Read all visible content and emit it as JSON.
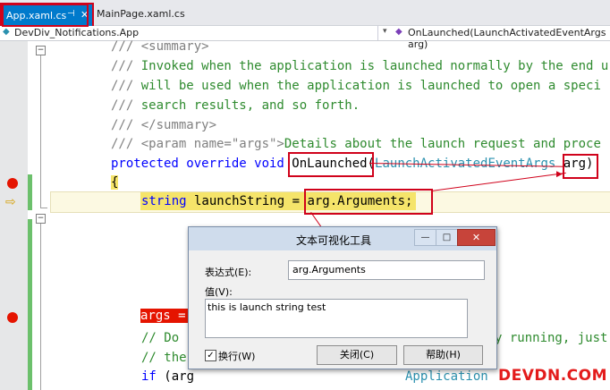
{
  "tabs": {
    "active": "App.xaml.cs",
    "active_pin": "⊣",
    "active_close": "✕",
    "second": "MainPage.xaml.cs"
  },
  "navbar": {
    "class_selector": "DevDiv_Notifications.App",
    "member_selector": "OnLaunched(LaunchActivatedEventArgs arg)"
  },
  "code": {
    "l1": "/// <summary>",
    "l2": "/// Invoked when the application is launched normally by the end u",
    "l3": "/// will be used when the application is launched to open a speci",
    "l4": "/// search results, and so forth.",
    "l5": "/// </summary>",
    "l6_pre": "/// <param name=\"args\">",
    "l6_post": "Details about the launch request and proce",
    "l7_kw": "protected override void ",
    "l7_method": "OnLaunched",
    "l7_paren": "(",
    "l7_type": "LaunchActivatedEventArgs ",
    "l7_arg": "arg",
    "l7_close": ")",
    "l8": "{",
    "l9_kw": "string",
    "l9_mid": " launchString = ",
    "l9_expr": "arg.Arguments;",
    "l14": "args = ",
    "l15a": "// Do ",
    "l15b": "y running, just",
    "l16": "// the",
    "l17a": "if (arg",
    "l17b": "Application"
  },
  "dialog": {
    "title": "文本可视化工具",
    "expr_label": "表达式(E):",
    "expr_value": "arg.Arguments",
    "value_label": "值(V):",
    "value_text": "this is launch string test",
    "wrap_label": "换行(W)",
    "wrap_checked": "✓",
    "close_button": "关闭(C)",
    "help_button": "帮助(H)",
    "min_glyph": "—",
    "max_glyph": "□",
    "close_glyph": "✕"
  },
  "watermark": "DEVDN.COM",
  "colors": {
    "accent": "#007acc",
    "breakpoint": "#e51400",
    "annotation_red": "#d0021b"
  }
}
